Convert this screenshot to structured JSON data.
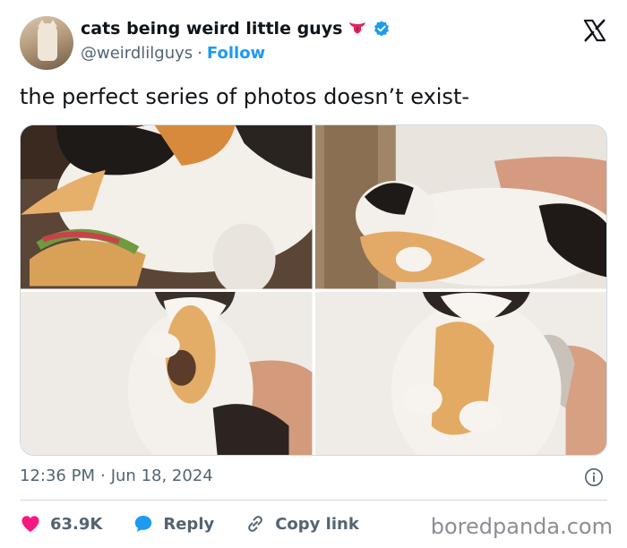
{
  "author": {
    "display_name": "cats being weird little guys",
    "emoji": "tongue-emoji",
    "handle": "@weirdlilguys",
    "separator": "·",
    "follow_label": "Follow",
    "verified": true
  },
  "tweet": {
    "text": "the perfect series of photos doesn’t exist-"
  },
  "media": {
    "photos": [
      {
        "description": "calico cat biting a sandwich"
      },
      {
        "description": "cat hugging a sandwich lying down"
      },
      {
        "description": "fluffy cat holding a sandwich upright"
      },
      {
        "description": "fluffy cat clutching a sandwich close-up"
      }
    ]
  },
  "meta": {
    "time": "12:36 PM",
    "separator": "·",
    "date": "Jun 18, 2024"
  },
  "actions": {
    "like_count": "63.9K",
    "reply_label": "Reply",
    "copy_link_label": "Copy link"
  },
  "watermark": "boredpanda.com",
  "colors": {
    "accent": "#1d9bf0",
    "like": "#f91880",
    "secondary_text": "#536471"
  }
}
